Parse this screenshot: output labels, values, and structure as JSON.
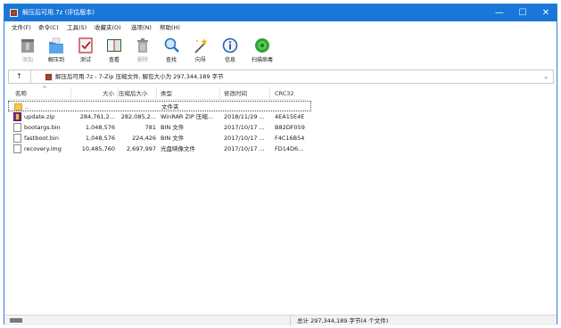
{
  "window": {
    "title": "解压后可用.7z (评估版本)",
    "controls": {
      "minimize": "—",
      "maximize": "☐",
      "close": "✕"
    }
  },
  "menu": [
    "文件(F)",
    "命令(C)",
    "工具(S)",
    "收藏夹(O)",
    "选项(N)",
    "帮助(H)"
  ],
  "toolbar": [
    {
      "label": "添加",
      "icon": "add-archive-icon",
      "enabled": false
    },
    {
      "label": "解压到",
      "icon": "extract-to-icon",
      "enabled": true
    },
    {
      "label": "测试",
      "icon": "test-icon",
      "enabled": true
    },
    {
      "label": "查看",
      "icon": "view-icon",
      "enabled": true
    },
    {
      "label": "删除",
      "icon": "delete-icon",
      "enabled": false
    },
    {
      "label": "查找",
      "icon": "find-icon",
      "enabled": true
    },
    {
      "label": "向导",
      "icon": "wizard-icon",
      "enabled": true
    },
    {
      "label": "信息",
      "icon": "info-icon",
      "enabled": true
    },
    {
      "label": "扫描病毒",
      "icon": "virus-scan-icon",
      "enabled": true
    }
  ],
  "address": {
    "up_glyph": "↑",
    "path": "解压后可用.7z - 7-Zip 压缩文件, 解包大小为 297,344,189 字节",
    "dropdown_glyph": "⌄"
  },
  "columns": {
    "name": "名称",
    "size": "大小",
    "packed": "压缩后大小",
    "type": "类型",
    "modified": "修改时间",
    "crc": "CRC32"
  },
  "files": [
    {
      "name": "..",
      "size": "",
      "packed": "",
      "type": "文件夹",
      "modified": "",
      "crc": "",
      "icon": "folder-icon"
    },
    {
      "name": "update.zip",
      "size": "284,761,2...",
      "packed": "282,085,2...",
      "type": "WinRAR ZIP 压缩...",
      "modified": "2018/11/29 ...",
      "crc": "4EA15E4E",
      "icon": "zip-icon"
    },
    {
      "name": "bootargs.bin",
      "size": "1,048,576",
      "packed": "781",
      "type": "BIN 文件",
      "modified": "2017/10/17 ...",
      "crc": "B82DF059",
      "icon": "file-icon"
    },
    {
      "name": "fastboot.bin",
      "size": "1,048,576",
      "packed": "224,426",
      "type": "BIN 文件",
      "modified": "2017/10/17 ...",
      "crc": "F4C16B54",
      "icon": "file-icon"
    },
    {
      "name": "recovery.img",
      "size": "10,485,760",
      "packed": "2,697,997",
      "type": "光盘映像文件",
      "modified": "2017/10/17 ...",
      "crc": "FD14D6...",
      "icon": "file-icon"
    }
  ],
  "status": {
    "summary": "总计 297,344,189 字节(4 个文件)"
  }
}
